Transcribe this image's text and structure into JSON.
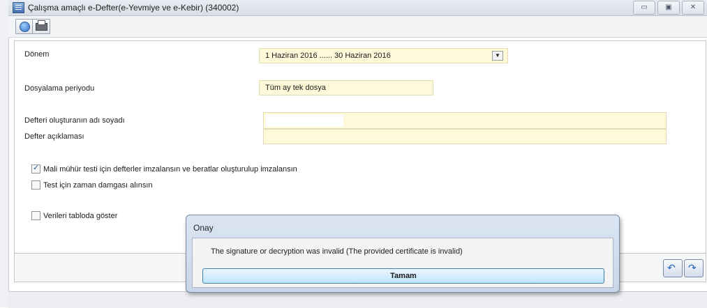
{
  "window": {
    "title": "Çalışma amaçlı e-Defter(e-Yevmiye ve e-Kebir) (340002)",
    "buttons": [
      "▭",
      "▣",
      "✕"
    ]
  },
  "toolbar": {
    "buttons": [
      "globe-icon",
      "printer-icon"
    ]
  },
  "form": {
    "donem_label": "Dönem",
    "donem_value": "1 Haziran 2016 ...... 30 Haziran 2016",
    "dosyalama_label": "Dosyalama periyodu",
    "dosyalama_value": "Tüm ay tek dosya",
    "olusturan_label": "Defteri oluşturanın adı soyadı",
    "olusturan_value": "",
    "aciklama_label": "Defter açıklaması",
    "aciklama_value": ""
  },
  "checkboxes": [
    {
      "label": "Mali mühür testi için defterler imzalansın ve beratlar oluşturulup imzalansın",
      "checked": true
    },
    {
      "label": "Test için zaman damgası alınsın",
      "checked": false
    },
    {
      "label": "Verileri tabloda göster",
      "checked": false
    }
  ],
  "dialog": {
    "title": "Onay",
    "message": "The signature or decryption was invalid (The provided certificate is invalid)",
    "ok_label": "Tamam"
  },
  "colors": {
    "field_bg": "#fdf9d9",
    "dialog_bg": "#c9d6e8",
    "button_bg": "#bee6fd"
  }
}
